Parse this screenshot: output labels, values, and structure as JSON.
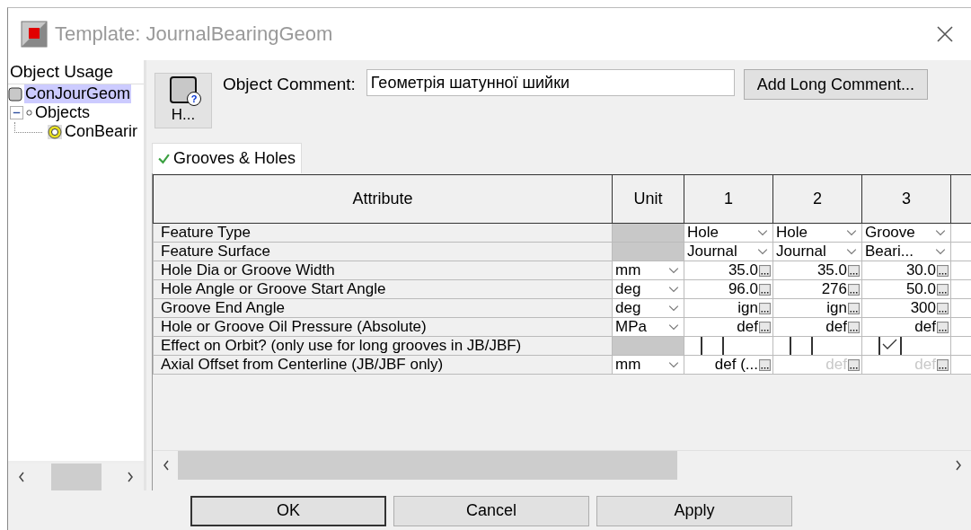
{
  "window": {
    "title": "Template: JournalBearingGeom"
  },
  "sidebar": {
    "header": "Object Usage",
    "tree": [
      {
        "label": "ConJourGeom",
        "selected": true
      },
      {
        "label": "Objects",
        "expanded": true,
        "selected": false,
        "children": [
          {
            "label": "ConBearir",
            "selected": false
          }
        ]
      }
    ]
  },
  "toolbar": {
    "help_button": "H...",
    "help_badge": "?",
    "comment_label": "Object Comment:",
    "comment_value": "Геометрія шатунної шийки",
    "long_comment_button": "Add Long Comment..."
  },
  "tabs": [
    {
      "label": "Grooves & Holes",
      "selected": true
    }
  ],
  "table": {
    "columns": [
      "Attribute",
      "Unit",
      "1",
      "2",
      "3"
    ],
    "rows": [
      {
        "cells": [
          {
            "kind": "text",
            "value": "Feature Type"
          },
          {
            "kind": "blank"
          },
          {
            "kind": "select",
            "value": "Hole"
          },
          {
            "kind": "select",
            "value": "Hole"
          },
          {
            "kind": "select",
            "value": "Groove"
          }
        ]
      },
      {
        "cells": [
          {
            "kind": "text",
            "value": "Feature Surface"
          },
          {
            "kind": "blank"
          },
          {
            "kind": "select",
            "value": "Journal"
          },
          {
            "kind": "select",
            "value": "Journal"
          },
          {
            "kind": "select",
            "value": "Beari..."
          }
        ]
      },
      {
        "cells": [
          {
            "kind": "text",
            "value": "Hole Dia or Groove Width"
          },
          {
            "kind": "select",
            "value": "mm"
          },
          {
            "kind": "value",
            "value": "35.0",
            "disabled": false
          },
          {
            "kind": "value",
            "value": "35.0",
            "disabled": false
          },
          {
            "kind": "value",
            "value": "30.0",
            "disabled": false
          }
        ]
      },
      {
        "cells": [
          {
            "kind": "text",
            "value": "Hole Angle or Groove Start Angle"
          },
          {
            "kind": "select",
            "value": "deg"
          },
          {
            "kind": "value",
            "value": "96.0",
            "disabled": false
          },
          {
            "kind": "value",
            "value": "276",
            "disabled": false
          },
          {
            "kind": "value",
            "value": "50.0",
            "disabled": false
          }
        ]
      },
      {
        "cells": [
          {
            "kind": "text",
            "value": "Groove End Angle"
          },
          {
            "kind": "select",
            "value": "deg"
          },
          {
            "kind": "value",
            "value": "ign",
            "disabled": false
          },
          {
            "kind": "value",
            "value": "ign",
            "disabled": false
          },
          {
            "kind": "value",
            "value": "300",
            "disabled": false
          }
        ]
      },
      {
        "cells": [
          {
            "kind": "text",
            "value": "Hole or Groove Oil Pressure (Absolute)"
          },
          {
            "kind": "select",
            "value": "MPa"
          },
          {
            "kind": "value",
            "value": "def",
            "disabled": false
          },
          {
            "kind": "value",
            "value": "def",
            "disabled": false
          },
          {
            "kind": "value",
            "value": "def",
            "disabled": false
          }
        ]
      },
      {
        "cells": [
          {
            "kind": "text",
            "value": "Effect on Orbit? (only use for long grooves in JB/JBF)"
          },
          {
            "kind": "blank"
          },
          {
            "kind": "check",
            "checked": false
          },
          {
            "kind": "check",
            "checked": false
          },
          {
            "kind": "check",
            "checked": true
          }
        ]
      },
      {
        "cells": [
          {
            "kind": "text",
            "value": "Axial Offset from Centerline (JB/JBF only)"
          },
          {
            "kind": "select",
            "value": "mm"
          },
          {
            "kind": "value",
            "value": "def (...",
            "disabled": false
          },
          {
            "kind": "value",
            "value": "def",
            "disabled": true
          },
          {
            "kind": "value",
            "value": "def",
            "disabled": true
          }
        ]
      }
    ]
  },
  "buttons": [
    "OK",
    "Cancel",
    "Apply"
  ]
}
